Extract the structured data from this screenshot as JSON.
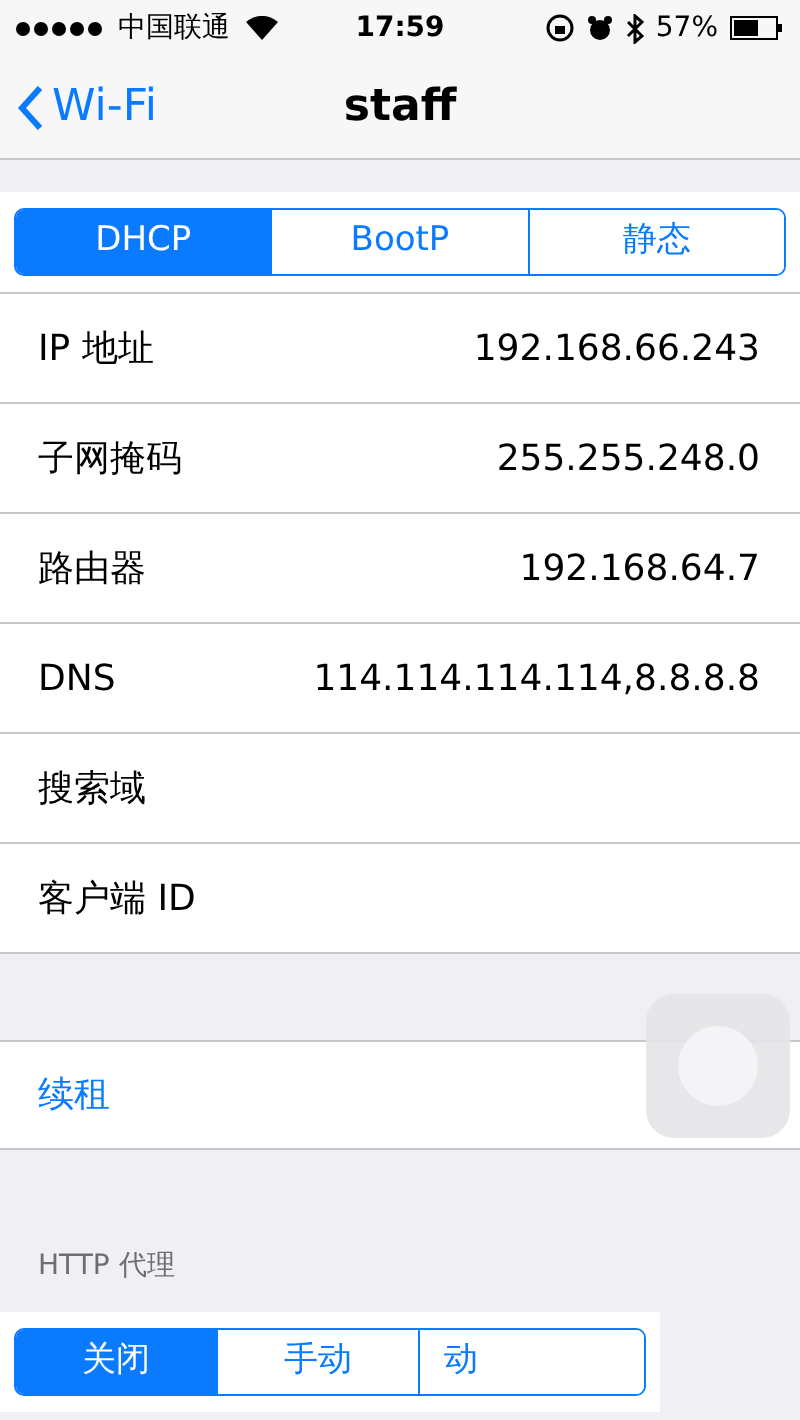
{
  "status_bar": {
    "carrier": "中国联通",
    "time": "17:59",
    "battery": "57%"
  },
  "nav": {
    "back": "Wi-Fi",
    "title": "staff"
  },
  "ip_mode": [
    {
      "label": "DHCP",
      "selected": true
    },
    {
      "label": "BootP",
      "selected": false
    },
    {
      "label": "静态",
      "selected": false
    }
  ],
  "rows": [
    {
      "label": "IP 地址",
      "value": "192.168.66.243"
    },
    {
      "label": "子网掩码",
      "value": "255.255.248.0"
    },
    {
      "label": "路由器",
      "value": "192.168.64.7"
    },
    {
      "label": "DNS",
      "value": "114.114.114.114,8.8.8.8"
    },
    {
      "label": "搜索域"
    },
    {
      "label": "客户端 ID"
    }
  ],
  "renew": "续租",
  "proxy": {
    "header": "HTTP 代理",
    "modes": [
      {
        "label": "关闭",
        "selected": true
      },
      {
        "label": "手动",
        "selected": false
      },
      {
        "label": "动",
        "selected": false
      }
    ]
  }
}
